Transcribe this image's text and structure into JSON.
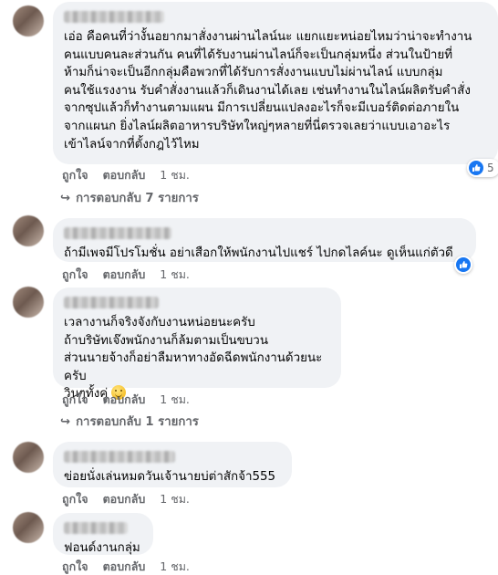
{
  "comments": [
    {
      "text": "เอ่อ คือคนที่ว่างั้นอยากมาสั่งงานผ่านไลน์นะ แยกแยะหน่อยไหมว่าน่าจะทำงาน\nคนแบบคนละส่วนกัน คนที่ได้รับงานผ่านไลน์ก็จะเป็นกลุ่มหนึ่ง ส่วนในป้ายที่\nห้ามก็น่าจะเป็นอีกกลุ่มคือพวกที่ได้รับการสั่งงานแบบไม่ผ่านไลน์ แบบกลุ่ม\nคนใช้แรงงาน รับคำสั่งงานแล้วก็เดินงานได้เลย เช่นทำงานในไลน์ผลิตรับคำสั่ง\nจากซุปแล้วก็ทำงานตามแผน มีการเปลี่ยนแปลงอะไรก็จะมีเบอร์ติดต่อภายใน\nจากแผนก ยิ่งไลน์ผลิตอาหารบริษัทใหญ่ๆหลายที่นี่ตรวจเลยว่าแบบเอาอะไร\nเข้าไลน์จากที่ตั้งกฎไว้ไหม",
      "like": "ถูกใจ",
      "reply": "ตอบกลับ",
      "time": "1 ชม.",
      "reaction_count": "5",
      "replies_label": "การตอบกลับ 7 รายการ"
    },
    {
      "text": "ถ้ามีเพจมีโปรโมชั่น อย่าเสือกให้พนักงานไปแชร์ ไปกดไลค์นะ ดูเห็นแก่ตัวดี",
      "like": "ถูกใจ",
      "reply": "ตอบกลับ",
      "time": "1 ชม."
    },
    {
      "text": "เวลางานก็จริงจังกับงานหน่อยนะครับ\nถ้าบริษัทเจ๊งพนักงานก็ล้มตามเป็นขบวน\nส่วนนายจ้างก็อย่าลืมหาทางอัดฉีดพนักงานด้วยนะครับ\nวินๆทั้งคู่",
      "like": "ถูกใจ",
      "reply": "ตอบกลับ",
      "time": "1 ชม.",
      "replies_label": "การตอบกลับ 1 รายการ"
    },
    {
      "text": "ข่อยนั่งเล่นหมดวันเจ้านายบ่ต่าสักจ้า555",
      "like": "ถูกใจ",
      "reply": "ตอบกลับ",
      "time": "1 ชม."
    },
    {
      "text": "ฟอนด์งานกลุ่ม",
      "like": "ถูกใจ",
      "reply": "ตอบกลับ",
      "time": "1 ชม."
    }
  ],
  "colors": {
    "bubble": "#f0f2f5",
    "meta_text": "#65676b",
    "like_blue": "#1877f2"
  },
  "icons": [
    "avatar-blurred",
    "reply-arrow-icon",
    "like-reaction-icon",
    "smile-emoji-icon"
  ]
}
